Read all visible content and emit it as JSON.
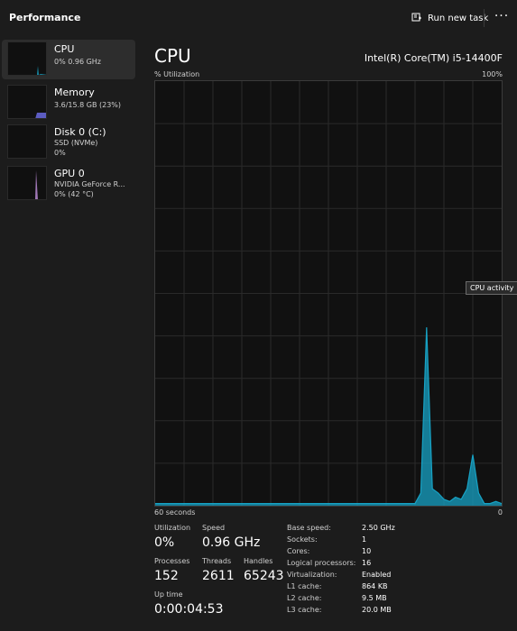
{
  "header": {
    "title": "Performance",
    "run_task_label": "Run new task",
    "more_label": "···"
  },
  "sidebar": {
    "items": [
      {
        "title": "CPU",
        "sub1": "0%  0.96 GHz",
        "sub2": "",
        "color": "#17a2c4"
      },
      {
        "title": "Memory",
        "sub1": "3.6/15.8 GB (23%)",
        "sub2": "",
        "color": "#6a6ae0"
      },
      {
        "title": "Disk 0 (C:)",
        "sub1": "SSD (NVMe)",
        "sub2": "0%",
        "color": "#64a33a"
      },
      {
        "title": "GPU 0",
        "sub1": "NVIDIA GeForce R...",
        "sub2": "0%  (42 °C)",
        "color": "#b083c9"
      }
    ]
  },
  "main": {
    "title": "CPU",
    "cpu_model": "Intel(R) Core(TM) i5-14400F",
    "util_label": "% Utilization",
    "util_max": "100%",
    "axis_left": "60 seconds",
    "axis_right": "0",
    "tooltip": "CPU activity",
    "accent": "#17a2c4"
  },
  "stats": {
    "utilization_label": "Utilization",
    "utilization_value": "0%",
    "speed_label": "Speed",
    "speed_value": "0.96 GHz",
    "processes_label": "Processes",
    "processes_value": "152",
    "threads_label": "Threads",
    "threads_value": "2611",
    "handles_label": "Handles",
    "handles_value": "65243",
    "uptime_label": "Up time",
    "uptime_value": "0:00:04:53"
  },
  "specs": [
    {
      "label": "Base speed:",
      "value": "2.50 GHz"
    },
    {
      "label": "Sockets:",
      "value": "1"
    },
    {
      "label": "Cores:",
      "value": "10"
    },
    {
      "label": "Logical processors:",
      "value": "16"
    },
    {
      "label": "Virtualization:",
      "value": "Enabled"
    },
    {
      "label": "L1 cache:",
      "value": "864 KB"
    },
    {
      "label": "L2 cache:",
      "value": "9.5 MB"
    },
    {
      "label": "L3 cache:",
      "value": "20.0 MB"
    }
  ],
  "chart_data": {
    "type": "area",
    "xlabel": "",
    "ylabel": "% Utilization",
    "xlim": [
      60,
      0
    ],
    "ylim": [
      0,
      100
    ],
    "grid": true,
    "x": [
      60,
      59,
      58,
      57,
      56,
      55,
      54,
      53,
      52,
      51,
      50,
      49,
      48,
      47,
      46,
      45,
      44,
      43,
      42,
      41,
      40,
      39,
      38,
      37,
      36,
      35,
      34,
      33,
      32,
      31,
      30,
      29,
      28,
      27,
      26,
      25,
      24,
      23,
      22,
      21,
      20,
      19,
      18,
      17,
      16,
      15,
      14,
      13,
      12,
      11,
      10,
      9,
      8,
      7,
      6,
      5,
      4,
      3,
      2,
      1,
      0
    ],
    "series": [
      {
        "values": [
          0.5,
          0.5,
          0.5,
          0.5,
          0.5,
          0.5,
          0.5,
          0.5,
          0.5,
          0.5,
          0.5,
          0.5,
          0.5,
          0.5,
          0.5,
          0.5,
          0.5,
          0.5,
          0.5,
          0.5,
          0.5,
          0.5,
          0.5,
          0.5,
          0.5,
          0.5,
          0.5,
          0.5,
          0.5,
          0.5,
          0.5,
          0.5,
          0.5,
          0.5,
          0.5,
          0.5,
          0.5,
          0.5,
          0.5,
          0.5,
          0.5,
          0.5,
          0.5,
          0.5,
          0.5,
          0.5,
          3,
          42,
          4,
          3,
          1.5,
          1,
          2,
          1.5,
          4,
          12,
          3,
          0.5,
          0.5,
          1,
          0.5
        ]
      }
    ]
  }
}
